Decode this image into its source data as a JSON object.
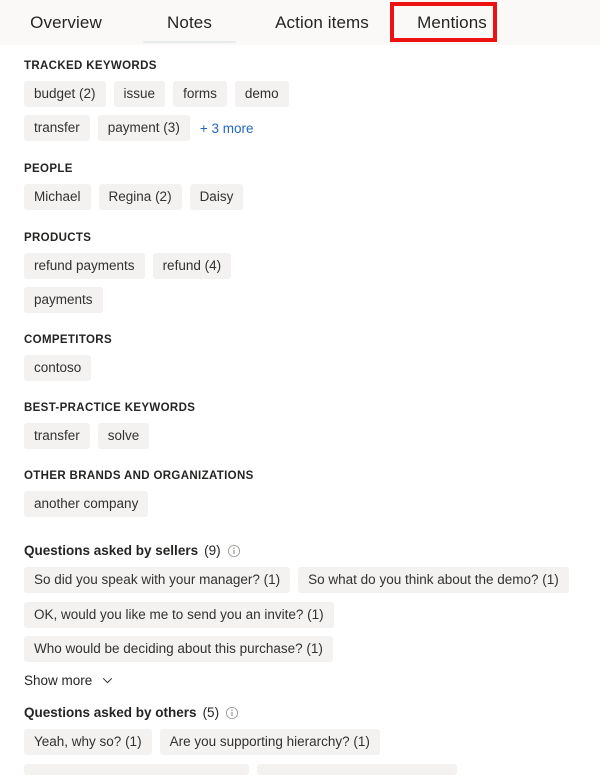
{
  "tabs": [
    {
      "label": "Overview",
      "active": false
    },
    {
      "label": "Notes",
      "active": true
    },
    {
      "label": "Action items",
      "active": false
    },
    {
      "label": "Mentions",
      "active": false
    }
  ],
  "annotation": {
    "target": "Mentions",
    "color": "#ee1111"
  },
  "colors": {
    "chip_background": "#f3f2f1",
    "link": "#2368c4",
    "text": "#252423",
    "tabbar_background": "#faf9f8",
    "active_tab_underline": "#e6ecec"
  },
  "sections": [
    {
      "title": "TRACKED KEYWORDS",
      "rows": [
        [
          "budget (2)",
          "issue",
          "forms",
          "demo"
        ],
        [
          "transfer",
          "payment (3)"
        ]
      ],
      "more_link": "+ 3 more"
    },
    {
      "title": "PEOPLE",
      "rows": [
        [
          "Michael",
          "Regina (2)",
          "Daisy"
        ]
      ],
      "more_link": null
    },
    {
      "title": "PRODUCTS",
      "rows": [
        [
          "refund payments",
          "refund (4)"
        ],
        [
          "payments"
        ]
      ],
      "more_link": null
    },
    {
      "title": "COMPETITORS",
      "rows": [
        [
          "contoso"
        ]
      ],
      "more_link": null
    },
    {
      "title": "BEST-PRACTICE KEYWORDS",
      "rows": [
        [
          "transfer",
          "solve"
        ]
      ],
      "more_link": null
    },
    {
      "title": "OTHER BRANDS AND ORGANIZATIONS",
      "rows": [
        [
          "another company"
        ]
      ],
      "more_link": null
    }
  ],
  "questions_sellers": {
    "label": "Questions asked by sellers",
    "count": "(9)",
    "info_icon": "info-circle-icon",
    "rows": [
      [
        "So did you speak with your manager? (1)",
        "So what do you think about the demo? (1)"
      ],
      [
        "OK, would you like me to send you an invite? (1)",
        "Who would be deciding about this purchase? (1)"
      ]
    ],
    "show_more_label": "Show more",
    "show_more_icon": "chevron-down-icon"
  },
  "questions_others": {
    "label": "Questions asked by others",
    "count": "(5)",
    "info_icon": "info-circle-icon",
    "rows": [
      [
        "Yeah, why so? (1)",
        "Are you supporting hierarchy? (1)"
      ],
      [
        "",
        ""
      ]
    ]
  }
}
